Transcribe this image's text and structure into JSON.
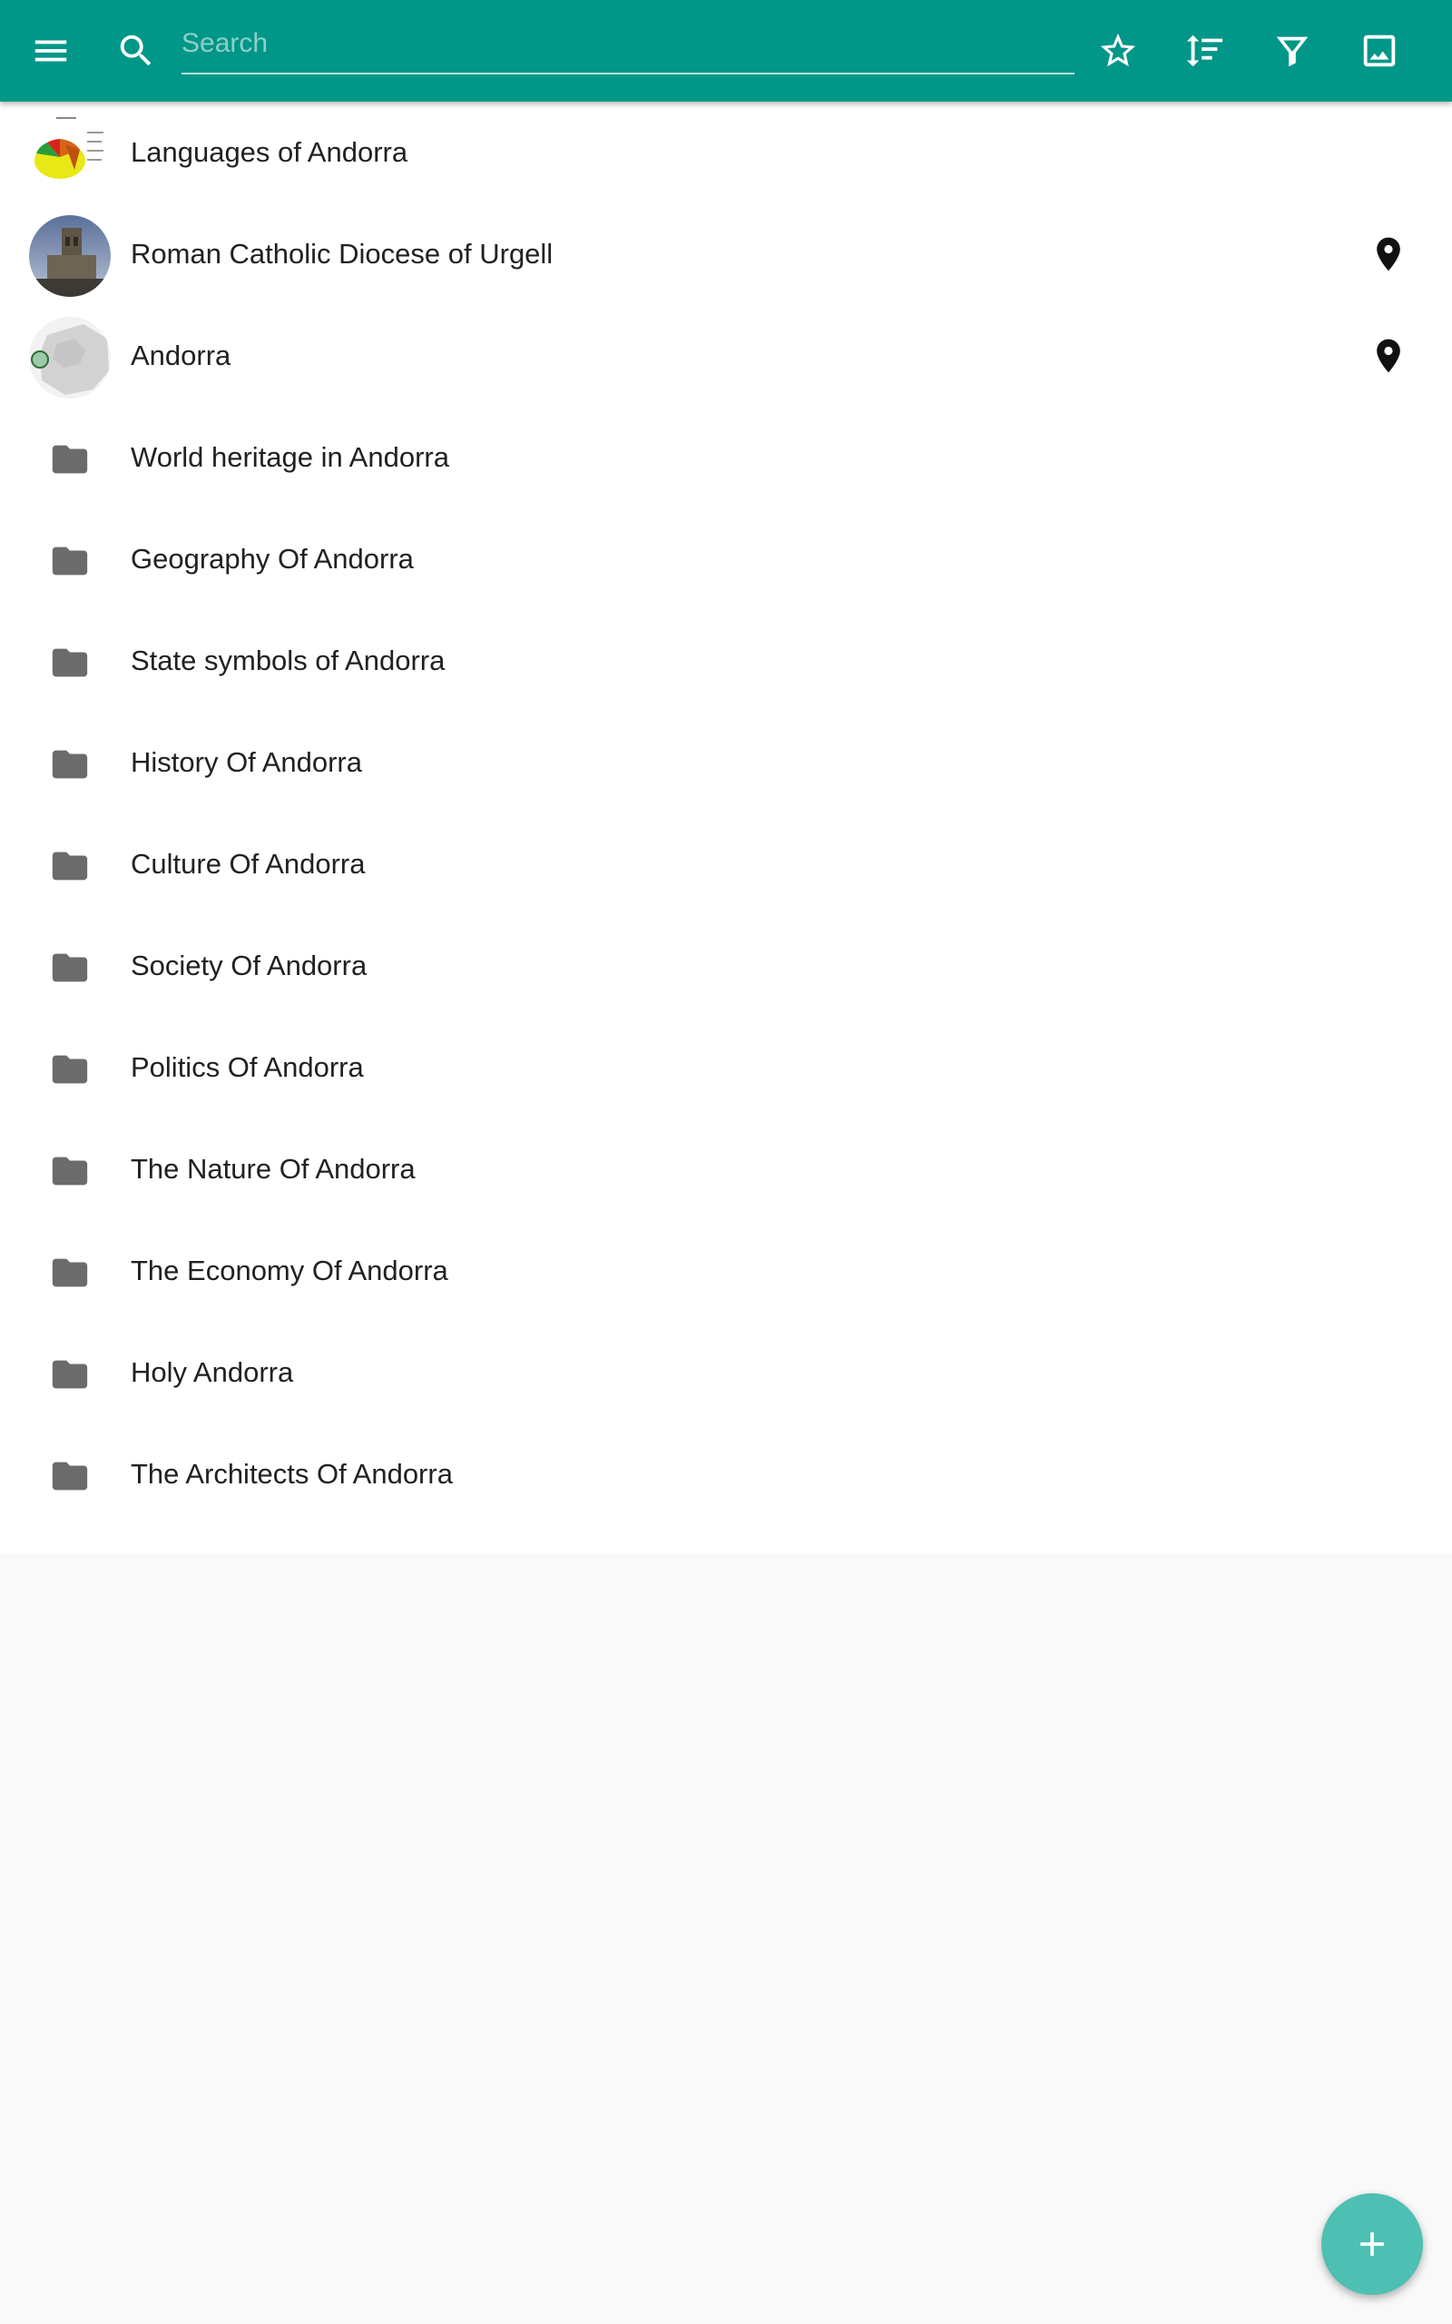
{
  "toolbar": {
    "menu_icon": "menu-icon",
    "search_icon": "search-icon",
    "search_placeholder": "Search",
    "search_value": "",
    "actions": [
      "star-outline-icon",
      "sort-icon",
      "filter-icon",
      "image-icon"
    ],
    "accent_color": "#009688"
  },
  "items": [
    {
      "label": "Languages of Andorra",
      "lead": "pie-chart-thumbnail",
      "pinned": false
    },
    {
      "label": "Roman Catholic Diocese of Urgell",
      "lead": "cathedral-photo-thumbnail",
      "pinned": true
    },
    {
      "label": "Andorra",
      "lead": "europe-map-thumbnail",
      "pinned": true
    },
    {
      "label": "World heritage in Andorra",
      "lead": "folder-icon",
      "pinned": false
    },
    {
      "label": "Geography Of Andorra",
      "lead": "folder-icon",
      "pinned": false
    },
    {
      "label": "State symbols of Andorra",
      "lead": "folder-icon",
      "pinned": false
    },
    {
      "label": "History Of Andorra",
      "lead": "folder-icon",
      "pinned": false
    },
    {
      "label": "Culture Of Andorra",
      "lead": "folder-icon",
      "pinned": false
    },
    {
      "label": "Society Of Andorra",
      "lead": "folder-icon",
      "pinned": false
    },
    {
      "label": "Politics Of Andorra",
      "lead": "folder-icon",
      "pinned": false
    },
    {
      "label": "The Nature Of Andorra",
      "lead": "folder-icon",
      "pinned": false
    },
    {
      "label": "The Economy Of Andorra",
      "lead": "folder-icon",
      "pinned": false
    },
    {
      "label": "Holy Andorra",
      "lead": "folder-icon",
      "pinned": false
    },
    {
      "label": "The Architects Of Andorra",
      "lead": "folder-icon",
      "pinned": false
    }
  ],
  "trailing_icon": "map-pin-icon",
  "fab": {
    "icon": "plus-icon",
    "color": "#4dbfb3"
  }
}
